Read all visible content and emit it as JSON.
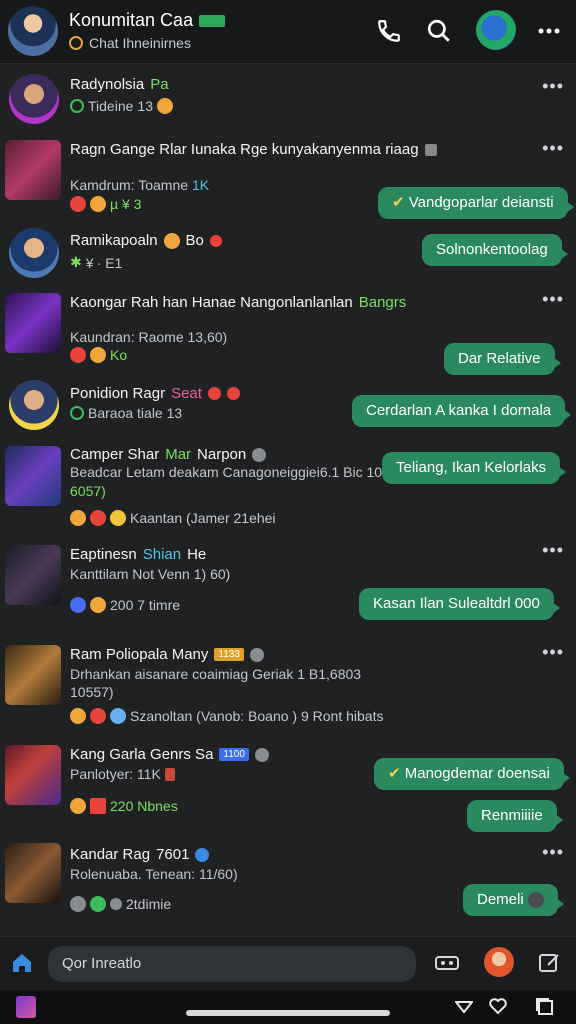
{
  "header": {
    "title": "Konumitan Caa",
    "subtitle": "Chat Ihneinirnes",
    "icons": [
      "phone-icon",
      "search-icon",
      "globe-avatar",
      "more-icon"
    ]
  },
  "rows": [
    {
      "name": "Radynolsia",
      "name_accent": "Pa",
      "sub": "Tideine",
      "sub_extra": "13"
    },
    {
      "name": "Ragn Gange Rlar Iunaka Rge kunyakanyenma riaag",
      "sub": "Kamdrum: Toamne",
      "sub_extra": "1K",
      "reactions": "µ ¥ 3",
      "bubble": "Vandgoparlar deiansti"
    },
    {
      "name": "Ramikapoaln",
      "name_extra": "Bo",
      "sub": "¥ ∙ E1",
      "bubble": "Solnonkentoolag"
    },
    {
      "name": "Kaongar Rah han Hanae Nangonlanlanlan",
      "name_accent": "Bangrs",
      "sub": "Kaundran: Raome 13,60)",
      "reactions": "Ko",
      "bubble": "Dar Relative"
    },
    {
      "name": "Ponidion Ragr",
      "name_accent": "Seat",
      "sub": "Baraoa tiale 13",
      "bubble": "Cerdarlan A kanka I dornala"
    },
    {
      "name": "Camper Shar",
      "name_accent": "Mar",
      "name_extra": "Narpon",
      "sub": "Beadcar Letam deakam Canagoneiggiei6.1 Bic 10",
      "sub_line2": "6057)",
      "sub_line3": "Kaantan (Jamer 21ehei",
      "bubble": "Teliang, Ikan Kelorlaks"
    },
    {
      "name": "Eaptinesn",
      "name_accent": "Shian",
      "name_extra": "He",
      "sub": "Kanttilam Not Venn 1) 60)",
      "sub_line3": "200 7 timre",
      "bubble": "Kasan Ilan Sulealtdrl 000"
    },
    {
      "name": "Ram Poliopala Many",
      "name_tag": "1133",
      "sub": "Drhankan aisanare coaimiag Geriak 1 B1,6803",
      "sub_line2": "10557)",
      "sub_line3": "Szanoltan (Vanob: Boano ) 9 Ront hibats"
    },
    {
      "name": "Kang Garla Genrs Sa",
      "name_tag": "1100",
      "sub": "Panlotyer: 11K",
      "sub_line3": "220 Nbnes",
      "bubble": "Manogdemar doensai",
      "bubble2": "Renmiiiie"
    },
    {
      "name": "Kandar Rag",
      "name_extra": "7601",
      "sub": "Rolenuaba. Tenean: 11/60)",
      "sub_line3": "2tdimie",
      "bubble": "Demeli"
    }
  ],
  "composer": {
    "placeholder": "Qor Inreatlo"
  },
  "colors": {
    "accent": "#2a8a5e",
    "background": "#1f2123",
    "header": "#16181a"
  }
}
